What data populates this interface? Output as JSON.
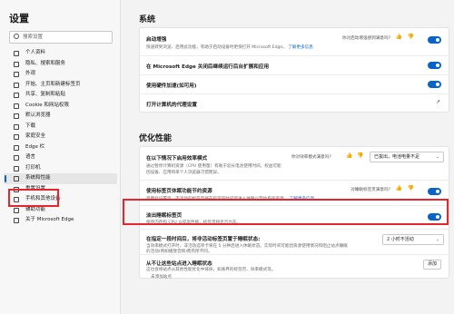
{
  "sidebar": {
    "title": "设置",
    "search_placeholder": "搜索设置",
    "items": [
      {
        "label": "个人资料"
      },
      {
        "label": "隐私、搜索和服务"
      },
      {
        "label": "外观"
      },
      {
        "label": "开始、主页和新建标签页"
      },
      {
        "label": "共享、复制和粘贴"
      },
      {
        "label": "Cookie 和网站权限"
      },
      {
        "label": "默认浏览器"
      },
      {
        "label": "下载"
      },
      {
        "label": "家庭安全"
      },
      {
        "label": "Edge 栏"
      },
      {
        "label": "语言"
      },
      {
        "label": "打印机"
      },
      {
        "label": "系统和性能"
      },
      {
        "label": "重置设置"
      },
      {
        "label": "手机和其他设备"
      },
      {
        "label": "辅助功能"
      },
      {
        "label": "关于 Microsoft Edge"
      }
    ]
  },
  "system": {
    "title": "系统",
    "startup_boost": {
      "label": "启动增强",
      "desc": "快速转到浏览、启用此功能，有助于启动设备时更快打开 Microsoft Edge。",
      "link": "了解更多信息",
      "feedback": "你对启动增强感到满意吗?"
    },
    "background": {
      "label": "在 Microsoft Edge 关闭后继续运行后台扩展和应用"
    },
    "hardware": {
      "label": "使用硬件加速(如可用)"
    },
    "proxy": {
      "label": "打开计算机的代理设置"
    }
  },
  "performance": {
    "title": "优化性能",
    "efficiency": {
      "label": "在以下情况下启用效率模式",
      "desc1": "通过暂停计算机资源（CPU 使用量）有助于延长电池使用时间。权益可能",
      "desc2": "因设备、应用和单个人浏览器习惯而异。",
      "feedback": "你对效率模式满意吗?",
      "dropdown": "已拔出，电池电量不足"
    },
    "sleeping_tabs": {
      "label": "使用标签页休眠功能节约资源",
      "desc": "启用此设置后，不活动的标签页将在指定的时间后进入休眠以节约系统资源。",
      "link": "了解更多信息",
      "feedback": "对睡眠标签页满意吗?"
    },
    "fade": {
      "label": "淡出睡眠标签页",
      "desc": "保存内存和 CPU 以提高性能，标签页将显示为灰。"
    },
    "inactive": {
      "label": "在指定一段时间后，将非活动标签页置于睡眠状态:",
      "desc1": "当效率模式打开时，非活动选项卡将在 5 分钟后进入休眠状态。实际时间可能因资源使用情况和阻止站点睡眠",
      "desc2": "的活动(例如播放音频)而有所不同。",
      "dropdown": "2 小时不活动"
    },
    "never_sleep": {
      "label": "从不让这些站点进入睡眠状态",
      "desc": "这也会将站点从其他性能优化中排除，如丢弃的标签页、效率模式等。",
      "empty": "未添加站点",
      "add": "添加"
    }
  }
}
